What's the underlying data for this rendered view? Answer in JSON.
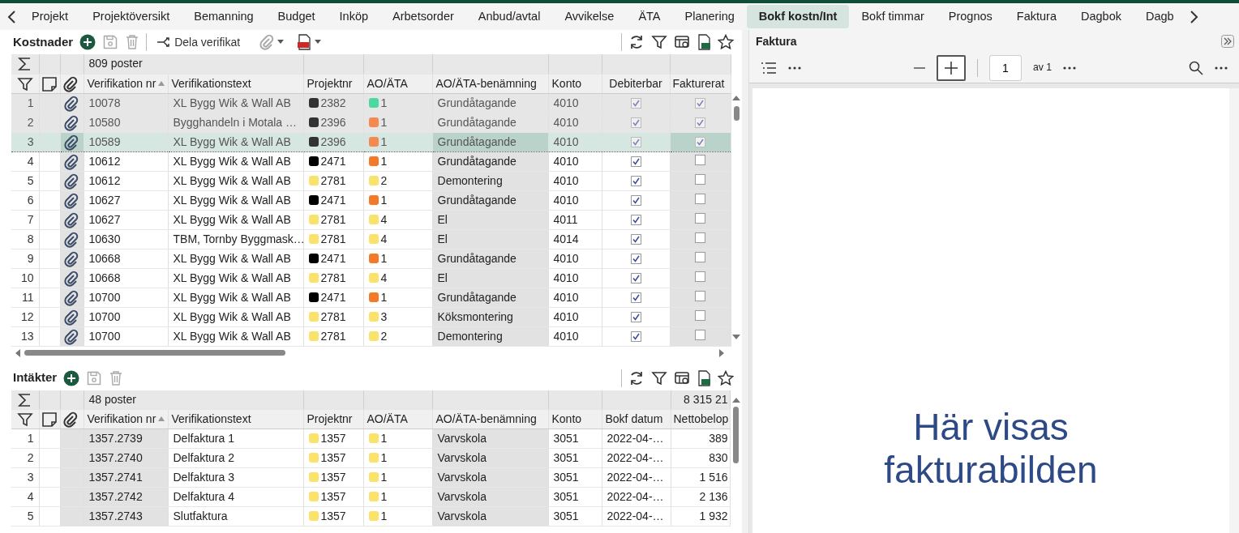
{
  "tabs": [
    {
      "label": "Projekt",
      "selected": false
    },
    {
      "label": "Projektöversikt",
      "selected": false
    },
    {
      "label": "Bemanning",
      "selected": false
    },
    {
      "label": "Budget",
      "selected": false
    },
    {
      "label": "Inköp",
      "selected": false
    },
    {
      "label": "Arbetsorder",
      "selected": false
    },
    {
      "label": "Anbud/avtal",
      "selected": false
    },
    {
      "label": "Avvikelse",
      "selected": false
    },
    {
      "label": "ÄTA",
      "selected": false
    },
    {
      "label": "Planering",
      "selected": false
    },
    {
      "label": "Bokf kostn/Int",
      "selected": true
    },
    {
      "label": "Bokf timmar",
      "selected": false
    },
    {
      "label": "Prognos",
      "selected": false
    },
    {
      "label": "Faktura",
      "selected": false
    },
    {
      "label": "Dagbok",
      "selected": false
    },
    {
      "label": "Dagb",
      "selected": false
    }
  ],
  "costs": {
    "title": "Kostnader",
    "share_label": "Dela verifikat",
    "count_label": "809 poster",
    "columns": [
      "Verifikation nr",
      "Verifikationstext",
      "Projektnr",
      "AO/ÄTA",
      "AO/ÄTA-benämning",
      "Konto",
      "Debiterbar",
      "Fakturerat"
    ],
    "rows": [
      {
        "num": "1",
        "verif_nr": "10078",
        "text": "XL Bygg Wik & Wall AB",
        "project": {
          "label": "2382",
          "color": "#333333"
        },
        "ao": {
          "label": "1",
          "color": "#4cd9a0"
        },
        "name": "Grundåtagande",
        "account": "4010",
        "billable": true,
        "invoiced": true,
        "disabled": true,
        "selected": false
      },
      {
        "num": "2",
        "verif_nr": "10580",
        "text": "Bygghandeln i Motala …",
        "project": {
          "label": "2396",
          "color": "#333333"
        },
        "ao": {
          "label": "1",
          "color": "#f48a4f"
        },
        "name": "Grundåtagande",
        "account": "4010",
        "billable": true,
        "invoiced": true,
        "disabled": true,
        "selected": false
      },
      {
        "num": "3",
        "verif_nr": "10589",
        "text": "XL Bygg Wik & Wall AB",
        "project": {
          "label": "2396",
          "color": "#333333"
        },
        "ao": {
          "label": "1",
          "color": "#f48a4f"
        },
        "name": "Grundåtagande",
        "account": "4010",
        "billable": true,
        "invoiced": true,
        "disabled": true,
        "selected": true
      },
      {
        "num": "4",
        "verif_nr": "10612",
        "text": "XL Bygg Wik & Wall AB",
        "project": {
          "label": "2471",
          "color": "#000000"
        },
        "ao": {
          "label": "1",
          "color": "#f47a2a"
        },
        "name": "Grundåtagande",
        "account": "4010",
        "billable": true,
        "invoiced": false,
        "disabled": false,
        "selected": false
      },
      {
        "num": "5",
        "verif_nr": "10612",
        "text": "XL Bygg Wik & Wall AB",
        "project": {
          "label": "2781",
          "color": "#fbe36b"
        },
        "ao": {
          "label": "2",
          "color": "#fbe36b"
        },
        "name": "Demontering",
        "account": "4010",
        "billable": true,
        "invoiced": false,
        "disabled": false,
        "selected": false
      },
      {
        "num": "6",
        "verif_nr": "10627",
        "text": "XL Bygg Wik & Wall AB",
        "project": {
          "label": "2471",
          "color": "#000000"
        },
        "ao": {
          "label": "1",
          "color": "#f47a2a"
        },
        "name": "Grundåtagande",
        "account": "4010",
        "billable": true,
        "invoiced": false,
        "disabled": false,
        "selected": false
      },
      {
        "num": "7",
        "verif_nr": "10627",
        "text": "XL Bygg Wik & Wall AB",
        "project": {
          "label": "2781",
          "color": "#fbe36b"
        },
        "ao": {
          "label": "4",
          "color": "#fbe36b"
        },
        "name": "El",
        "account": "4011",
        "billable": true,
        "invoiced": false,
        "disabled": false,
        "selected": false
      },
      {
        "num": "8",
        "verif_nr": "10630",
        "text": "TBM, Tornby Byggmask…",
        "project": {
          "label": "2781",
          "color": "#fbe36b"
        },
        "ao": {
          "label": "4",
          "color": "#fbe36b"
        },
        "name": "El",
        "account": "4014",
        "billable": true,
        "invoiced": false,
        "disabled": false,
        "selected": false
      },
      {
        "num": "9",
        "verif_nr": "10668",
        "text": "XL Bygg Wik & Wall AB",
        "project": {
          "label": "2471",
          "color": "#000000"
        },
        "ao": {
          "label": "1",
          "color": "#f47a2a"
        },
        "name": "Grundåtagande",
        "account": "4010",
        "billable": true,
        "invoiced": false,
        "disabled": false,
        "selected": false
      },
      {
        "num": "10",
        "verif_nr": "10668",
        "text": "XL Bygg Wik & Wall AB",
        "project": {
          "label": "2781",
          "color": "#fbe36b"
        },
        "ao": {
          "label": "4",
          "color": "#fbe36b"
        },
        "name": "El",
        "account": "4010",
        "billable": true,
        "invoiced": false,
        "disabled": false,
        "selected": false
      },
      {
        "num": "11",
        "verif_nr": "10700",
        "text": "XL Bygg Wik & Wall AB",
        "project": {
          "label": "2471",
          "color": "#000000"
        },
        "ao": {
          "label": "1",
          "color": "#f47a2a"
        },
        "name": "Grundåtagande",
        "account": "4010",
        "billable": true,
        "invoiced": false,
        "disabled": false,
        "selected": false
      },
      {
        "num": "12",
        "verif_nr": "10700",
        "text": "XL Bygg Wik & Wall AB",
        "project": {
          "label": "2781",
          "color": "#fbe36b"
        },
        "ao": {
          "label": "3",
          "color": "#fbe36b"
        },
        "name": "Köksmontering",
        "account": "4010",
        "billable": true,
        "invoiced": false,
        "disabled": false,
        "selected": false
      },
      {
        "num": "13",
        "verif_nr": "10700",
        "text": "XL Bygg Wik & Wall AB",
        "project": {
          "label": "2781",
          "color": "#fbe36b"
        },
        "ao": {
          "label": "2",
          "color": "#fbe36b"
        },
        "name": "Demontering",
        "account": "4010",
        "billable": true,
        "invoiced": false,
        "disabled": false,
        "selected": false
      }
    ]
  },
  "income": {
    "title": "Intäkter",
    "count_label": "48 poster",
    "sum_label": "8 315 21",
    "columns": [
      "Verifikation nr",
      "Verifikationstext",
      "Projektnr",
      "AO/ÄTA",
      "AO/ÄTA-benämning",
      "Konto",
      "Bokf datum",
      "Nettobelop"
    ],
    "rows": [
      {
        "num": "1",
        "verif_nr": "1357.2739",
        "text": "Delfaktura 1",
        "project": {
          "label": "1357",
          "color": "#fbe36b"
        },
        "ao": {
          "label": "1",
          "color": "#fbe36b"
        },
        "name": "Varvskola",
        "account": "3051",
        "date": "2022-04-…",
        "amount": "389"
      },
      {
        "num": "2",
        "verif_nr": "1357.2740",
        "text": "Delfaktura 2",
        "project": {
          "label": "1357",
          "color": "#fbe36b"
        },
        "ao": {
          "label": "1",
          "color": "#fbe36b"
        },
        "name": "Varvskola",
        "account": "3051",
        "date": "2022-04-…",
        "amount": "830"
      },
      {
        "num": "3",
        "verif_nr": "1357.2741",
        "text": "Delfaktura 3",
        "project": {
          "label": "1357",
          "color": "#fbe36b"
        },
        "ao": {
          "label": "1",
          "color": "#fbe36b"
        },
        "name": "Varvskola",
        "account": "3051",
        "date": "2022-04-…",
        "amount": "1 516"
      },
      {
        "num": "4",
        "verif_nr": "1357.2742",
        "text": "Delfaktura 4",
        "project": {
          "label": "1357",
          "color": "#fbe36b"
        },
        "ao": {
          "label": "1",
          "color": "#fbe36b"
        },
        "name": "Varvskola",
        "account": "3051",
        "date": "2022-04-…",
        "amount": "2 136"
      },
      {
        "num": "5",
        "verif_nr": "1357.2743",
        "text": "Slutfaktura",
        "project": {
          "label": "1357",
          "color": "#fbe36b"
        },
        "ao": {
          "label": "1",
          "color": "#fbe36b"
        },
        "name": "Varvskola",
        "account": "3051",
        "date": "2022-04-…",
        "amount": "1 932"
      }
    ]
  },
  "invoice_panel": {
    "title": "Faktura",
    "page": "1",
    "page_total": "av 1",
    "placeholder_text": "Här visas fakturabilden"
  }
}
